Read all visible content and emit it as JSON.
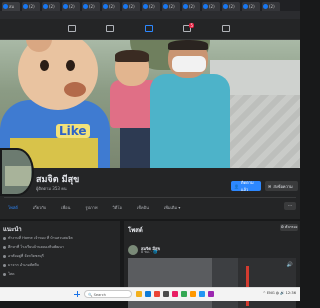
{
  "browser": {
    "tabs": [
      {
        "label": "สม",
        "icon": "facebook-icon"
      },
      {
        "label": "(2)",
        "icon": "facebook-icon"
      },
      {
        "label": "(2)",
        "icon": "facebook-icon"
      },
      {
        "label": "(2)",
        "icon": "facebook-icon"
      },
      {
        "label": "(2)",
        "icon": "facebook-icon"
      },
      {
        "label": "(2)",
        "icon": "facebook-icon"
      },
      {
        "label": "(2)",
        "icon": "facebook-icon"
      },
      {
        "label": "(2)",
        "icon": "facebook-icon"
      },
      {
        "label": "(2)",
        "icon": "facebook-icon"
      },
      {
        "label": "(2)",
        "icon": "facebook-icon"
      },
      {
        "label": "(2)",
        "icon": "facebook-icon"
      },
      {
        "label": "(2)",
        "icon": "facebook-icon"
      },
      {
        "label": "(2)",
        "icon": "facebook-icon"
      },
      {
        "label": "(2)",
        "icon": "facebook-icon"
      }
    ]
  },
  "fb_nav": {
    "badges": {
      "groups": "5"
    }
  },
  "profile": {
    "name": "สมจิต มีสุข",
    "followers": "ผู้ติดตาม 353 คน",
    "follow_button": "ติดตามแล้ว",
    "message_button": "ส่งข้อความ",
    "tabs": [
      "โพสต์",
      "เกี่ยวกับ",
      "เพื่อน",
      "รูปภาพ",
      "วิดีโอ",
      "เช็คอิน",
      "เพิ่มเติม ▾"
    ],
    "more_label": "···"
  },
  "intro": {
    "title": "แนะนำ",
    "items": [
      "ทำงานที่ Home เจ้าของ ที่ บ้านสวนสมจิต",
      "ศึกษาที่ โรงเรียนบ้านคลองหินพัฒนา",
      "อาศัยอยู่ที่ จังหวัดชลบุรี",
      "มาจาก อำเภอสัตหีบ",
      "โสด"
    ]
  },
  "posts": {
    "title": "โพสต์",
    "filter_label": "⚙ ตัวกรอง",
    "author": "สมจิต มีสุข",
    "time": "8 ชม. · 🌐",
    "volume_icon": "🔊"
  },
  "taskbar": {
    "search_placeholder": "🔍 Search",
    "tray_text": "^ ENG  ◍ 🔊 12:36"
  },
  "colors": {
    "accent": "#2d88ff",
    "background": "#18191a",
    "card": "#242526"
  }
}
